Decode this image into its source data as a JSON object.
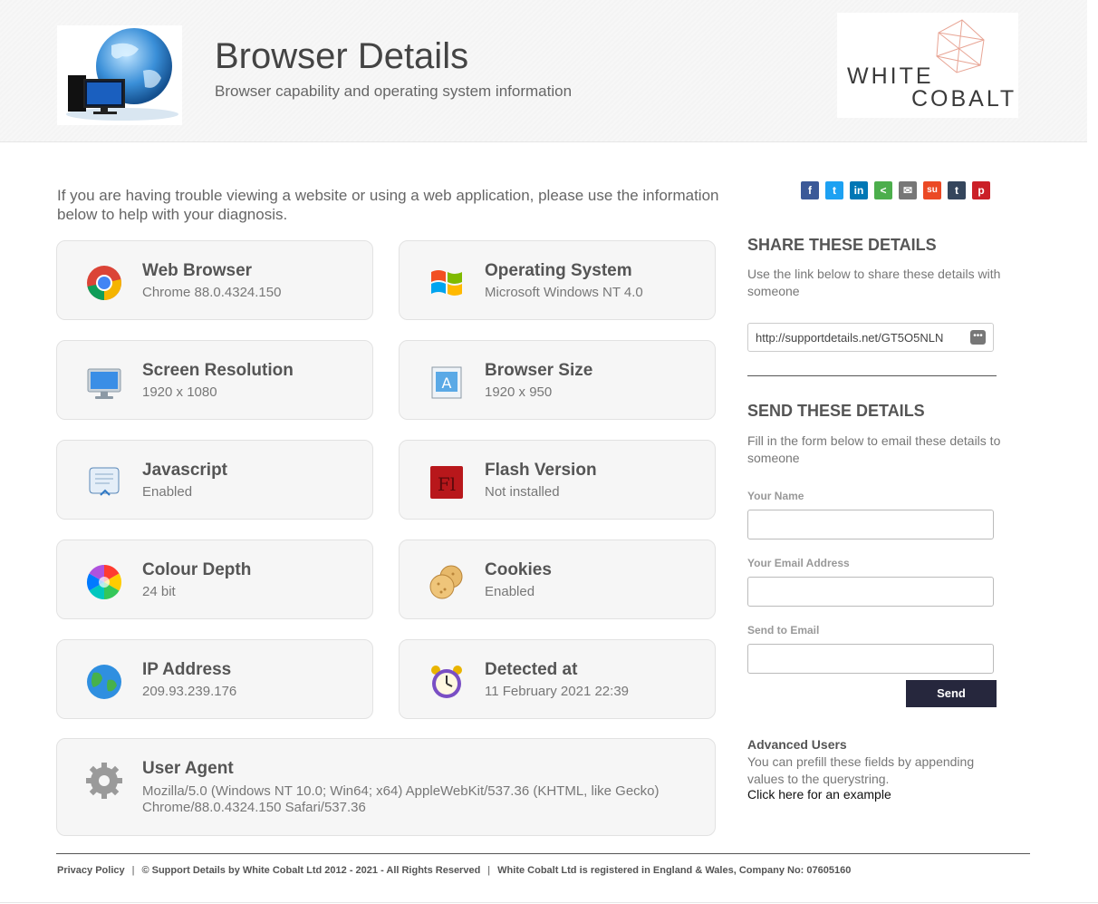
{
  "header": {
    "title": "Browser Details",
    "subtitle": "Browser capability and operating system information",
    "brand_line1": "WHITE",
    "brand_line2": "COBALT"
  },
  "intro": "If you are having trouble viewing a website or using a web application, please use the information below to help with your diagnosis.",
  "cards": {
    "web_browser": {
      "title": "Web Browser",
      "value": "Chrome 88.0.4324.150",
      "icon": "chrome-icon"
    },
    "operating_system": {
      "title": "Operating System",
      "value": "Microsoft Windows NT 4.0",
      "icon": "windows-icon"
    },
    "screen_resolution": {
      "title": "Screen Resolution",
      "value": "1920 x 1080",
      "icon": "monitor-icon"
    },
    "browser_size": {
      "title": "Browser Size",
      "value": "1920 x 950",
      "icon": "browser-size-icon"
    },
    "javascript": {
      "title": "Javascript",
      "value": "Enabled",
      "icon": "script-icon"
    },
    "flash_version": {
      "title": "Flash Version",
      "value": "Not installed",
      "icon": "flash-icon"
    },
    "colour_depth": {
      "title": "Colour Depth",
      "value": "24 bit",
      "icon": "color-wheel-icon"
    },
    "cookies": {
      "title": "Cookies",
      "value": "Enabled",
      "icon": "cookie-icon"
    },
    "ip_address": {
      "title": "IP Address",
      "value": "209.93.239.176",
      "icon": "globe-icon"
    },
    "detected_at": {
      "title": "Detected at",
      "value": "11 February 2021 22:39",
      "icon": "alarm-clock-icon"
    },
    "user_agent": {
      "title": "User Agent",
      "value": "Mozilla/5.0 (Windows NT 10.0; Win64; x64) AppleWebKit/537.36 (KHTML, like Gecko) Chrome/88.0.4324.150 Safari/537.36",
      "icon": "gear-icon"
    }
  },
  "share_icons": [
    {
      "name": "facebook-icon",
      "glyph": "f",
      "color": "#3b5998"
    },
    {
      "name": "twitter-icon",
      "glyph": "t",
      "color": "#1da1f2"
    },
    {
      "name": "linkedin-icon",
      "glyph": "in",
      "color": "#0077b5"
    },
    {
      "name": "share-icon",
      "glyph": "<",
      "color": "#4cae4c"
    },
    {
      "name": "email-icon",
      "glyph": "✉",
      "color": "#777777"
    },
    {
      "name": "stumbleupon-icon",
      "glyph": "su",
      "color": "#eb4924"
    },
    {
      "name": "tumblr-icon",
      "glyph": "t",
      "color": "#35465c"
    },
    {
      "name": "pinterest-icon",
      "glyph": "p",
      "color": "#cb2027"
    }
  ],
  "share": {
    "heading": "SHARE THESE DETAILS",
    "text": "Use the link below to share these details with someone",
    "link": "http://supportdetails.net/GT5O5NLN"
  },
  "send": {
    "heading": "SEND THESE DETAILS",
    "text": "Fill in the form below to email these details to someone",
    "name_label": "Your Name",
    "email_label": "Your Email Address",
    "to_label": "Send to Email",
    "button": "Send"
  },
  "advanced": {
    "heading": "Advanced Users",
    "text": "You can prefill these fields by appending values to the querystring.",
    "link": "Click here for an example"
  },
  "footer": {
    "privacy": "Privacy Policy",
    "copyright": "© Support Details by White Cobalt Ltd 2012 - 2021 - All Rights Reserved",
    "company": "White Cobalt Ltd is registered in England & Wales, Company No: 07605160",
    "separator": "|"
  }
}
